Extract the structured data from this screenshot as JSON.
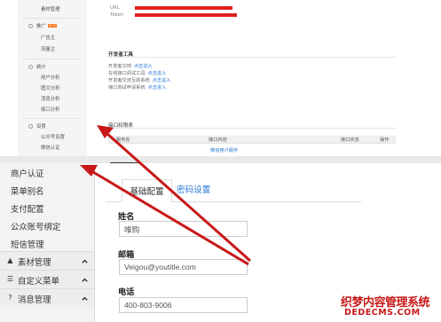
{
  "top": {
    "sidebar": {
      "material_manage": "素材管理",
      "promotion": {
        "label": "推广",
        "badge": "NEW",
        "items": [
          "广告主",
          "流量主"
        ]
      },
      "stats": {
        "label": "统计",
        "items": [
          "用户分析",
          "图文分析",
          "消息分析",
          "接口分析"
        ]
      },
      "settings": {
        "label": "设置",
        "items": [
          "公众号设置",
          "微信认证"
        ]
      }
    },
    "main": {
      "url_label": "URL",
      "token_label": "Token",
      "dev_tools": {
        "title": "开发者工具",
        "items": [
          {
            "label": "开发者文档",
            "link": "点击进入"
          },
          {
            "label": "在线接口调试工具",
            "link": "点击进入"
          },
          {
            "label": "开发者交流互助系统",
            "link": "点击进入"
          },
          {
            "label": "接口测试申请系统",
            "link": "点击进入"
          }
        ]
      },
      "permissions": {
        "title": "接口权限表",
        "columns": [
          "服务名",
          "接口内容",
          "接口状态",
          "操作"
        ],
        "row_content": "微信用户服务"
      }
    }
  },
  "bottom": {
    "sidebar": {
      "items": [
        "商户认证",
        "菜单别名",
        "支付配置",
        "公众账号绑定",
        "短信管理"
      ],
      "groups": [
        {
          "label": "素材管理",
          "icon": "bookmark-icon"
        },
        {
          "label": "自定义菜单",
          "icon": "menu-icon"
        },
        {
          "label": "消息管理",
          "icon": "help-icon"
        }
      ]
    },
    "main": {
      "tabs": [
        "基础配置",
        "密码设置"
      ],
      "fields": [
        {
          "label": "姓名",
          "value": "唯购"
        },
        {
          "label": "邮箱",
          "value": "Veigou@youtitle.com"
        },
        {
          "label": "电话",
          "value": "400-803-9006"
        }
      ]
    }
  },
  "watermark": {
    "line1": "织梦内容管理系统",
    "line2": "DEDECMS.COM"
  },
  "colors": {
    "accent": "#c81818",
    "link": "#2b7bd6"
  }
}
